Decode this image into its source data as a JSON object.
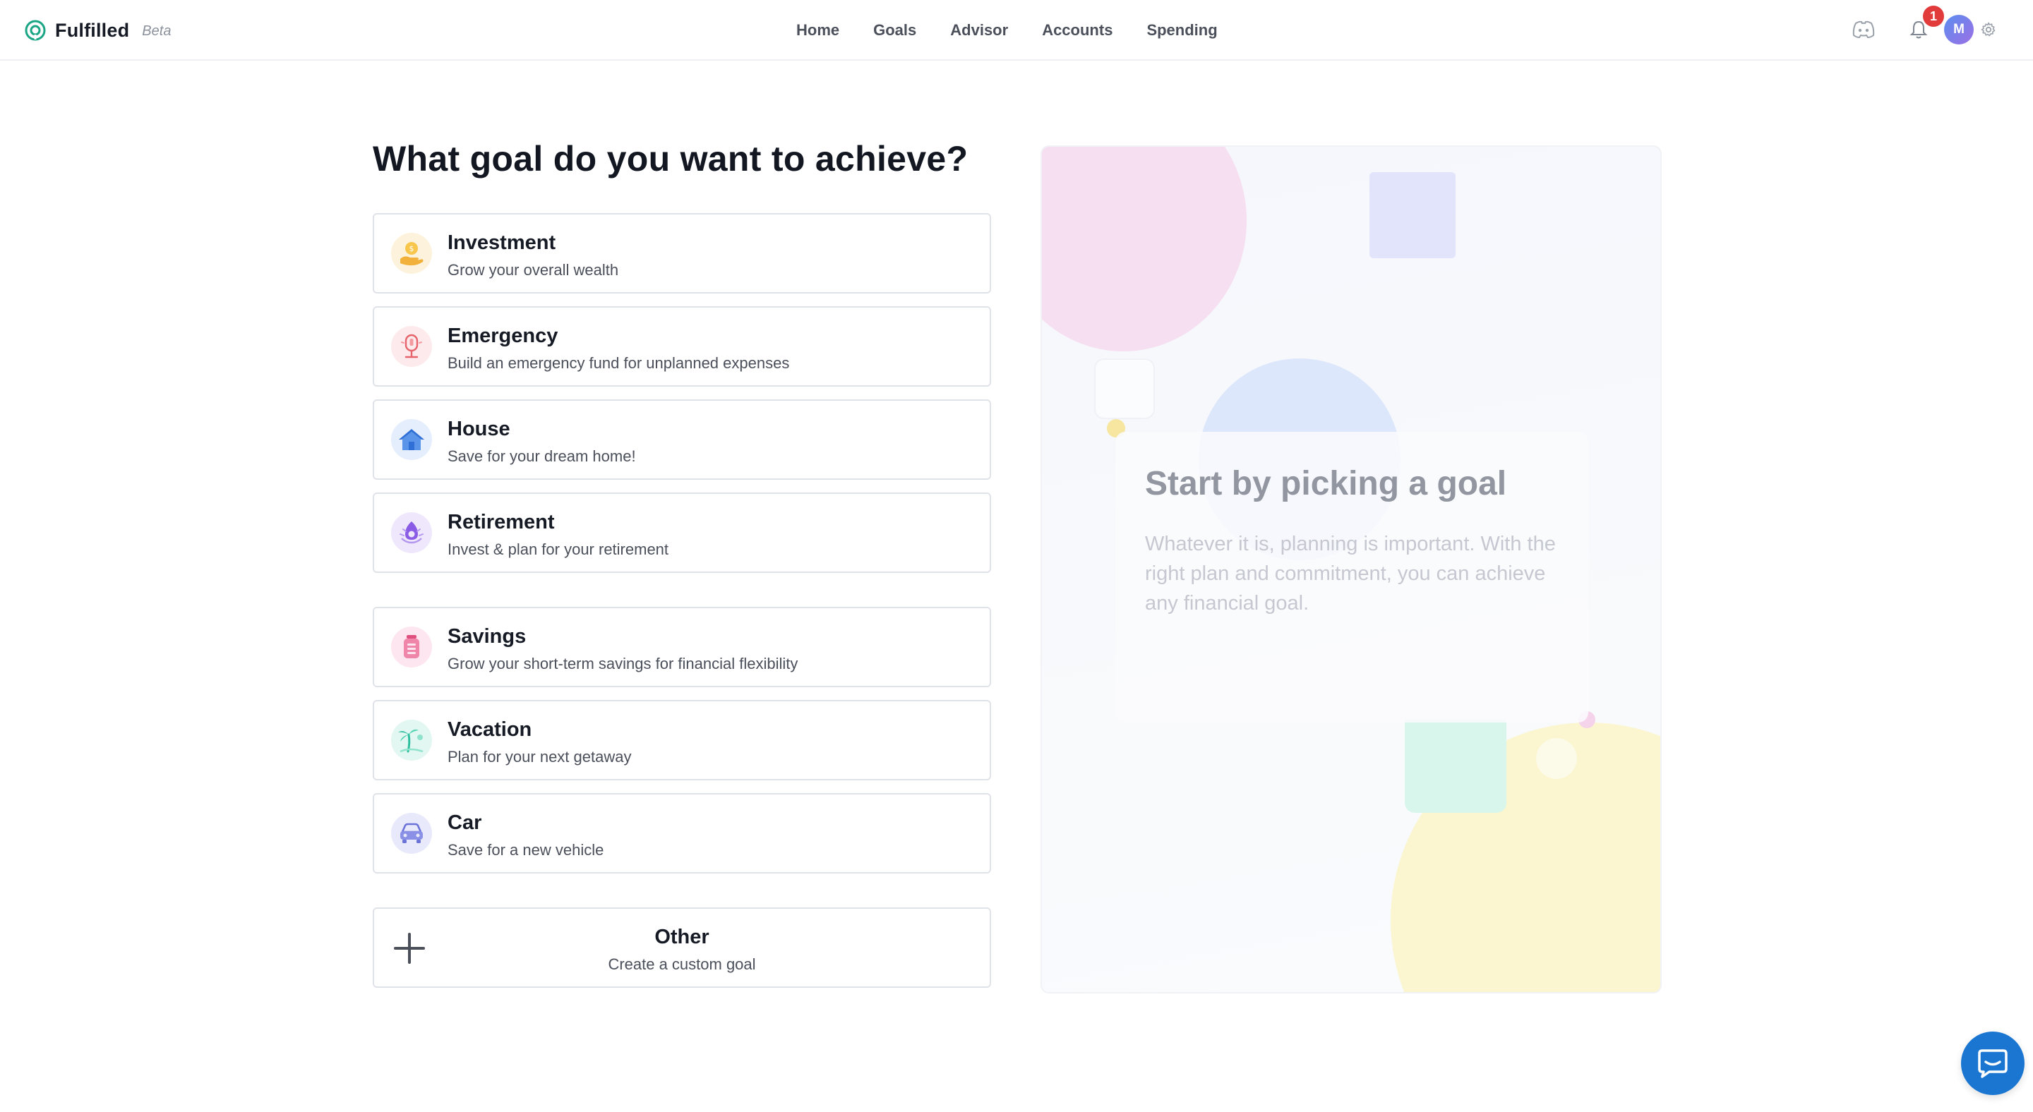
{
  "app": {
    "name": "Fulfilled",
    "badge": "Beta"
  },
  "nav": {
    "items": [
      {
        "label": "Home"
      },
      {
        "label": "Goals"
      },
      {
        "label": "Advisor"
      },
      {
        "label": "Accounts"
      },
      {
        "label": "Spending"
      }
    ]
  },
  "header_right": {
    "discord_icon": "discord-icon",
    "bell_icon": "bell-icon",
    "notification_count": "1",
    "avatar_initial": "M",
    "settings_icon": "gear-icon"
  },
  "main": {
    "title": "What goal do you want to achieve?",
    "goals": [
      {
        "title": "Investment",
        "description": "Grow your overall wealth",
        "icon": "money-bag-icon",
        "icon_color": "#f5b43b"
      },
      {
        "title": "Emergency",
        "description": "Build an emergency fund for unplanned expenses",
        "icon": "emergency-icon",
        "icon_color": "#e6636b"
      },
      {
        "title": "House",
        "description": "Save for your dream home!",
        "icon": "house-icon",
        "icon_color": "#4a86e8"
      },
      {
        "title": "Retirement",
        "description": "Invest & plan for your retirement",
        "icon": "retirement-icon",
        "icon_color": "#8a5ce6"
      },
      {
        "title": "Savings",
        "description": "Grow your short-term savings for financial flexibility",
        "icon": "savings-jar-icon",
        "icon_color": "#e0507f"
      },
      {
        "title": "Vacation",
        "description": "Plan for your next getaway",
        "icon": "palm-tree-icon",
        "icon_color": "#2fbf9e"
      },
      {
        "title": "Car",
        "description": "Save for a new vehicle",
        "icon": "car-icon",
        "icon_color": "#6b73d9"
      }
    ],
    "other": {
      "title": "Other",
      "description": "Create a custom goal",
      "icon": "plus-icon"
    }
  },
  "panel": {
    "title": "Start by picking a goal",
    "description": "Whatever it is, planning is important. With the right plan and commitment, you can achieve any financial goal."
  },
  "chat": {
    "icon": "chat-bubble-icon",
    "color": "#1b76d2"
  }
}
